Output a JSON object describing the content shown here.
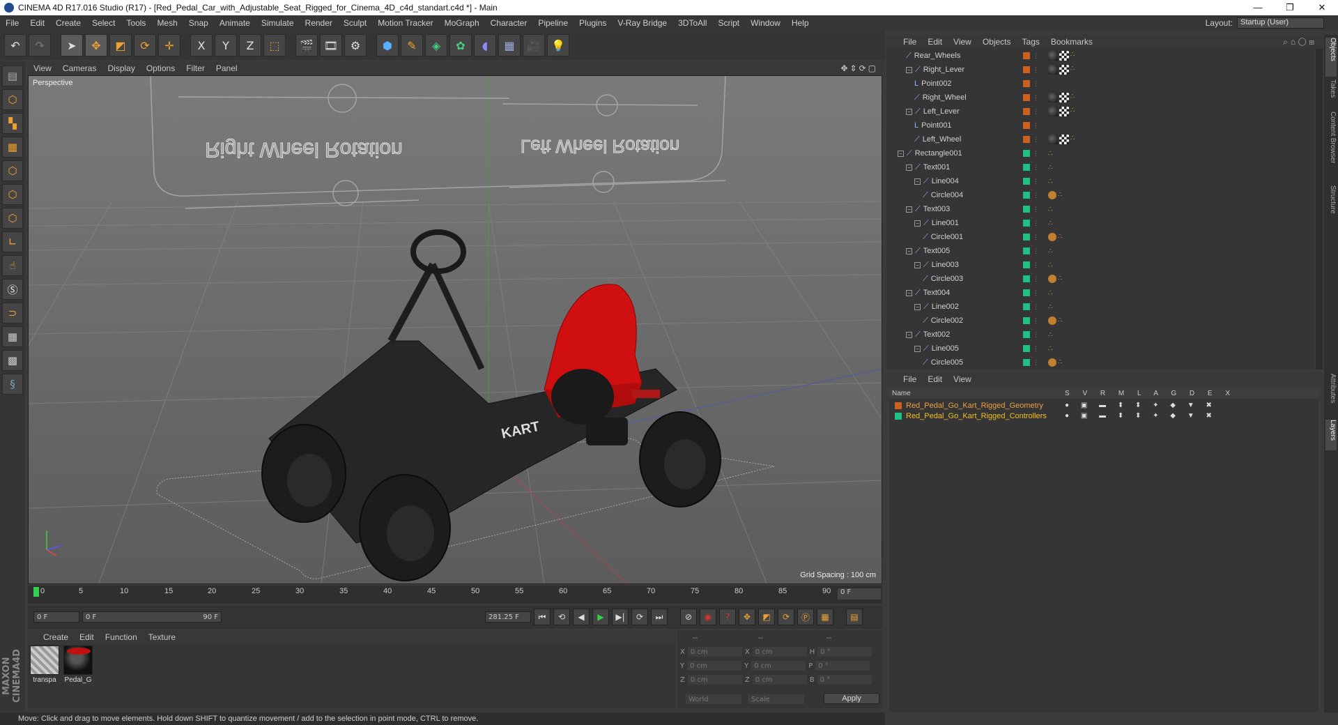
{
  "window": {
    "title": "CINEMA 4D R17.016 Studio (R17) - [Red_Pedal_Car_with_Adjustable_Seat_Rigged_for_Cinema_4D_c4d_standart.c4d *] - Main",
    "minimize": "—",
    "maximize": "❐",
    "close": "✕"
  },
  "menubar": {
    "items": [
      "File",
      "Edit",
      "Create",
      "Select",
      "Tools",
      "Mesh",
      "Snap",
      "Animate",
      "Simulate",
      "Render",
      "Sculpt",
      "Motion Tracker",
      "MoGraph",
      "Character",
      "Pipeline",
      "Plugins",
      "V-Ray Bridge",
      "3DToAll",
      "Script",
      "Window",
      "Help"
    ],
    "layout_label": "Layout:",
    "layout_value": "Startup (User)"
  },
  "toolbar": {
    "icons": [
      "undo-icon",
      "redo-icon",
      "select-arrow-icon",
      "move-icon",
      "scale-icon",
      "rotate-icon",
      "add-move-icon",
      "x-axis-icon",
      "y-axis-icon",
      "z-axis-icon",
      "world-coord-icon",
      "render-view-icon",
      "render-picture-viewer-icon",
      "render-settings-icon",
      "cube-icon",
      "pen-icon",
      "subdivision-icon",
      "array-icon",
      "deformer-icon",
      "floor-icon",
      "camera-icon",
      "light-icon"
    ],
    "axis_labels": [
      "X",
      "Y",
      "Z"
    ]
  },
  "viewport": {
    "menu": [
      "View",
      "Cameras",
      "Display",
      "Options",
      "Filter",
      "Panel"
    ],
    "label": "Perspective",
    "grid_spacing": "Grid Spacing : 100 cm",
    "ctrl_text_left": "Right Wheel Rotation",
    "ctrl_text_right": "Left Wheel Rotation",
    "kart_decal": "KART",
    "colors": {
      "seat": "#d01010",
      "frame": "#232323",
      "accent": "#b01818"
    }
  },
  "timeline": {
    "ticks": [
      "0",
      "5",
      "10",
      "15",
      "20",
      "25",
      "30",
      "35",
      "40",
      "45",
      "50",
      "55",
      "60",
      "65",
      "70",
      "75",
      "80",
      "85",
      "90"
    ],
    "frame_end": "0 F",
    "current_frame": "0 F",
    "range_start": "0 F",
    "range_end": "90 F",
    "fps_field": "281.25 F"
  },
  "material_manager": {
    "menu": [
      "Create",
      "Edit",
      "Function",
      "Texture"
    ],
    "materials": [
      {
        "name": "transpa",
        "swatch": "checker"
      },
      {
        "name": "Pedal_G",
        "swatch": "red-sphere"
      }
    ]
  },
  "coordinates": {
    "header": [
      "--",
      "--",
      "--"
    ],
    "rows": [
      {
        "a": "X",
        "av": "0 cm",
        "b": "X",
        "bv": "0 cm",
        "c": "H",
        "cv": "0 °"
      },
      {
        "a": "Y",
        "av": "0 cm",
        "b": "Y",
        "bv": "0 cm",
        "c": "P",
        "cv": "0 °"
      },
      {
        "a": "Z",
        "av": "0 cm",
        "b": "Z",
        "bv": "0 cm",
        "c": "B",
        "cv": "0 °"
      }
    ],
    "mode": "World",
    "scale": "Scale",
    "apply": "Apply"
  },
  "status": "Move: Click and drag to move elements. Hold down SHIFT to quantize movement / add to the selection in point mode, CTRL to remove.",
  "object_manager": {
    "menu": [
      "File",
      "Edit",
      "View",
      "Objects",
      "Tags",
      "Bookmarks"
    ],
    "rows": [
      {
        "name": "Rear_Wheels",
        "indent": 3,
        "layer": "#d06020",
        "tags": [
          "ball",
          "check",
          "dot"
        ]
      },
      {
        "name": "Right_Lever",
        "indent": 3,
        "expand": true,
        "layer": "#d06020",
        "tags": [
          "ball",
          "check",
          "dot"
        ]
      },
      {
        "name": "Point002",
        "indent": 4,
        "null": true,
        "layer": "#d06020",
        "tags": []
      },
      {
        "name": "Right_Wheel",
        "indent": 4,
        "layer": "#d06020",
        "tags": [
          "ball",
          "check",
          "dot"
        ]
      },
      {
        "name": "Left_Lever",
        "indent": 3,
        "expand": true,
        "layer": "#d06020",
        "tags": [
          "ball",
          "check",
          "dot"
        ]
      },
      {
        "name": "Point001",
        "indent": 4,
        "null": true,
        "layer": "#d06020",
        "tags": []
      },
      {
        "name": "Left_Wheel",
        "indent": 4,
        "layer": "#d06020",
        "tags": [
          "ball",
          "check",
          "dot"
        ]
      },
      {
        "name": "Rectangle001",
        "indent": 2,
        "expand": true,
        "layer": "#20c080",
        "tags": [
          "dot"
        ]
      },
      {
        "name": "Text001",
        "indent": 3,
        "expand": true,
        "layer": "#20c080",
        "tags": [
          "dot"
        ]
      },
      {
        "name": "Line004",
        "indent": 4,
        "expand": true,
        "layer": "#20c080",
        "tags": [
          "dot"
        ]
      },
      {
        "name": "Circle004",
        "indent": 5,
        "layer": "#20c080",
        "tags": [
          "noicon",
          "dot"
        ]
      },
      {
        "name": "Text003",
        "indent": 3,
        "expand": true,
        "layer": "#20c080",
        "tags": [
          "dot"
        ]
      },
      {
        "name": "Line001",
        "indent": 4,
        "expand": true,
        "layer": "#20c080",
        "tags": [
          "dot"
        ]
      },
      {
        "name": "Circle001",
        "indent": 5,
        "layer": "#20c080",
        "tags": [
          "noicon",
          "dot"
        ]
      },
      {
        "name": "Text005",
        "indent": 3,
        "expand": true,
        "layer": "#20c080",
        "tags": [
          "dot"
        ]
      },
      {
        "name": "Line003",
        "indent": 4,
        "expand": true,
        "layer": "#20c080",
        "tags": [
          "dot"
        ]
      },
      {
        "name": "Circle003",
        "indent": 5,
        "layer": "#20c080",
        "tags": [
          "noicon",
          "dot"
        ]
      },
      {
        "name": "Text004",
        "indent": 3,
        "expand": true,
        "layer": "#20c080",
        "tags": [
          "dot"
        ]
      },
      {
        "name": "Line002",
        "indent": 4,
        "expand": true,
        "layer": "#20c080",
        "tags": [
          "dot"
        ]
      },
      {
        "name": "Circle002",
        "indent": 5,
        "layer": "#20c080",
        "tags": [
          "noicon",
          "dot"
        ]
      },
      {
        "name": "Text002",
        "indent": 3,
        "expand": true,
        "layer": "#20c080",
        "tags": [
          "dot"
        ]
      },
      {
        "name": "Line005",
        "indent": 4,
        "expand": true,
        "layer": "#20c080",
        "tags": [
          "dot"
        ]
      },
      {
        "name": "Circle005",
        "indent": 5,
        "layer": "#20c080",
        "tags": [
          "noicon",
          "dot"
        ]
      }
    ]
  },
  "layer_manager": {
    "menu": [
      "File",
      "Edit",
      "View"
    ],
    "name_header": "Name",
    "columns": "S V R M L A G D E X",
    "layers": [
      {
        "name": "Red_Pedal_Go_Kart_Rigged_Geometry",
        "color": "#d06020",
        "text_color": "#f0a040"
      },
      {
        "name": "Red_Pedal_Go_Kart_Rigged_Controllers",
        "color": "#20c080",
        "text_color": "#f0c020"
      }
    ],
    "icons": "● ▣ ▬ ⬍ ⬍ ✦ ◆ ▼ ✖"
  },
  "side_tabs": [
    "Objects",
    "Takes",
    "Content Browser",
    "Structure",
    "Attributes",
    "Layers"
  ]
}
